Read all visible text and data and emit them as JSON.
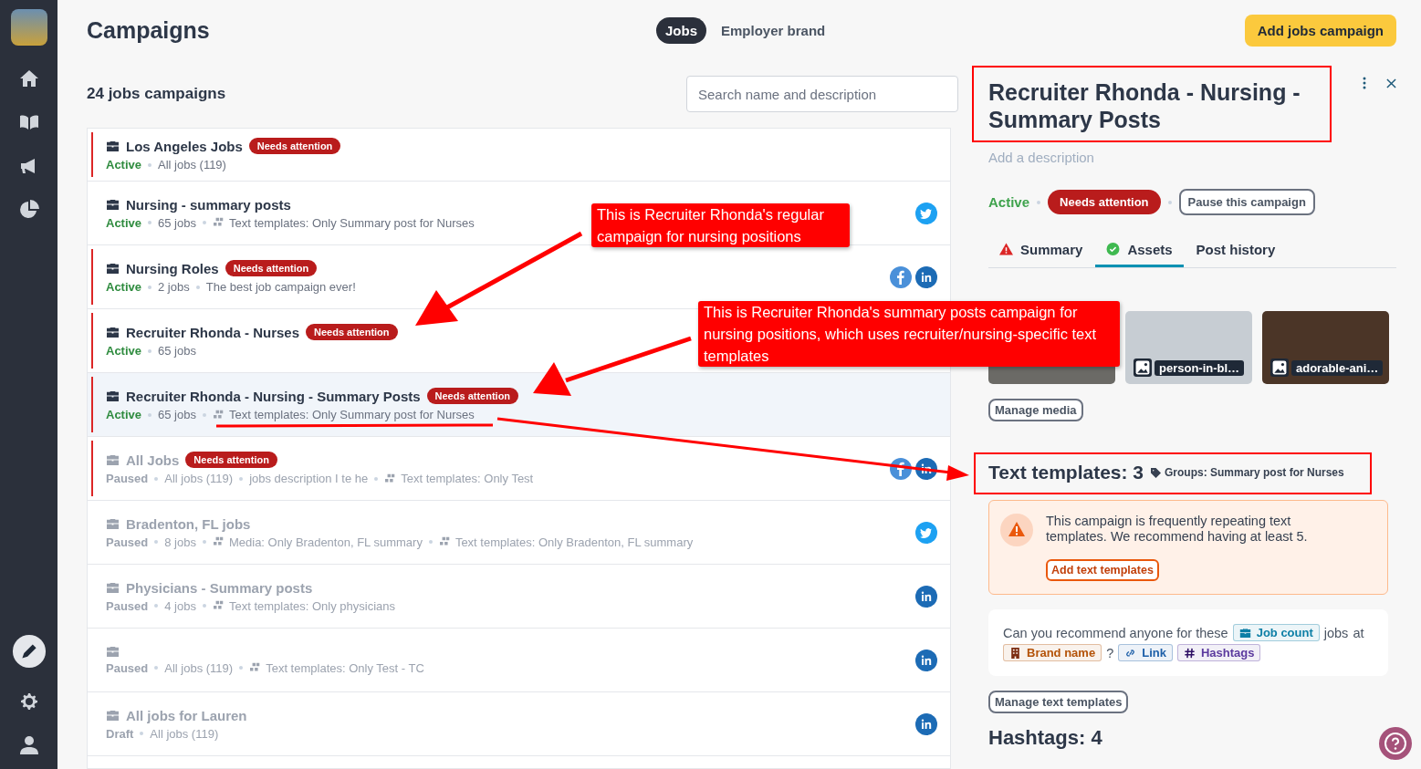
{
  "header": {
    "title": "Campaigns",
    "tabs": [
      {
        "label": "Jobs",
        "selected": true
      },
      {
        "label": "Employer brand",
        "selected": false
      }
    ],
    "action": "Add jobs campaign"
  },
  "list": {
    "count": "24 jobs campaigns",
    "search": {
      "placeholder": "Search name and description"
    },
    "campaigns": [
      {
        "title": "Los Angeles Jobs",
        "attention": "Needs attention",
        "status": "Active",
        "kind": "active",
        "selected": false,
        "meta": [
          {
            "text": "All jobs (119)",
            "group": false
          }
        ]
      },
      {
        "title": "Nursing - summary posts",
        "status": "Active",
        "kind": "active",
        "selected": false,
        "meta": [
          {
            "text": "65 jobs",
            "group": false
          },
          {
            "text": "Text templates: Only Summary post for Nurses",
            "group": true
          }
        ],
        "socials": [
          {
            "kind": "twitter"
          }
        ]
      },
      {
        "title": "Nursing Roles",
        "attention": "Needs attention",
        "status": "Active",
        "kind": "active",
        "selected": false,
        "meta": [
          {
            "text": "2 jobs",
            "group": false
          },
          {
            "text": "The best job campaign ever!",
            "group": false
          }
        ],
        "socials": [
          {
            "kind": "facebook"
          },
          {
            "kind": "linkedin"
          }
        ]
      },
      {
        "title": "Recruiter Rhonda - Nurses",
        "attention": "Needs attention",
        "status": "Active",
        "kind": "active",
        "selected": false,
        "meta": [
          {
            "text": "65 jobs",
            "group": false
          }
        ]
      },
      {
        "title": "Recruiter Rhonda - Nursing - Summary Posts",
        "attention": "Needs attention",
        "status": "Active",
        "kind": "active",
        "selected": true,
        "meta": [
          {
            "text": "65 jobs",
            "group": false
          },
          {
            "text": "Text templates: Only Summary post for Nurses",
            "group": true
          }
        ]
      },
      {
        "title": "All Jobs",
        "attention": "Needs attention",
        "status": "Paused",
        "kind": "paused",
        "selected": false,
        "meta": [
          {
            "text": "All jobs (119)",
            "group": false
          },
          {
            "text": "jobs description I te he",
            "group": false
          },
          {
            "text": "Text templates: Only Test",
            "group": true
          }
        ],
        "socials": [
          {
            "kind": "facebook"
          },
          {
            "kind": "linkedin"
          }
        ]
      },
      {
        "title": "Bradenton, FL jobs",
        "status": "Paused",
        "kind": "paused",
        "selected": false,
        "meta": [
          {
            "text": "8 jobs",
            "group": false
          },
          {
            "text": "Media: Only Bradenton, FL summary",
            "group": true
          },
          {
            "text": "Text templates: Only Bradenton, FL summary",
            "group": true
          }
        ],
        "socials": [
          {
            "kind": "twitter"
          }
        ]
      },
      {
        "title": "Physicians - Summary posts",
        "status": "Paused",
        "kind": "paused",
        "selected": false,
        "meta": [
          {
            "text": "4 jobs",
            "group": false
          },
          {
            "text": "Text templates: Only physicians",
            "group": true
          }
        ],
        "socials": [
          {
            "kind": "linkedin"
          }
        ]
      },
      {
        "status": "Paused",
        "kind": "paused",
        "selected": false,
        "meta": [
          {
            "text": "All jobs (119)",
            "group": false
          },
          {
            "text": "Text templates: Only Test - TC",
            "group": true
          }
        ],
        "socials": [
          {
            "kind": "linkedin"
          }
        ]
      },
      {
        "title": "All jobs for Lauren",
        "status": "Draft",
        "kind": "draft",
        "selected": false,
        "meta": [
          {
            "text": "All jobs (119)",
            "group": false
          }
        ],
        "socials": [
          {
            "kind": "linkedin"
          }
        ]
      }
    ]
  },
  "detail": {
    "title": "Recruiter Rhonda - Nursing - Summary Posts",
    "description": {
      "placeholder": "Add a description"
    },
    "status": "Active",
    "attention": "Needs attention",
    "pause": "Pause this campaign",
    "tabs": [
      {
        "label": "Summary",
        "warning": true,
        "complete": false,
        "selected": false
      },
      {
        "label": "Assets",
        "warning": false,
        "complete": true,
        "selected": true
      },
      {
        "label": "Post history",
        "warning": false,
        "complete": false,
        "selected": false
      }
    ],
    "media": {
      "thumbnails": [
        {
          "kind": "covered"
        },
        {
          "kind": "captioned",
          "caption": "person-in-bl…"
        },
        {
          "kind": "captioned",
          "caption": "adorable-ani…"
        }
      ],
      "button": "Manage media"
    },
    "templates": {
      "title": "Text templates: 3",
      "groups": "Groups: Summary post for Nurses",
      "warning": {
        "text": "This campaign is frequently repeating text templates. We recommend having at least 5.",
        "button": "Add text templates"
      },
      "preview": [
        {
          "kind": "text",
          "text": "Can you recommend anyone for these"
        },
        {
          "kind": "token",
          "text": "Job count",
          "color": "#0e7fa6"
        },
        {
          "kind": "text",
          "text": "jobs"
        },
        {
          "kind": "text",
          "text": "at"
        },
        {
          "kind": "token",
          "text": "Brand name",
          "color": "#b45309"
        },
        {
          "kind": "text",
          "text": "?"
        },
        {
          "kind": "token",
          "text": "Link",
          "color": "#1d5fa8"
        },
        {
          "kind": "token",
          "text": "Hashtags",
          "color": "#5b3a9e"
        }
      ],
      "button": "Manage text templates"
    },
    "hashtags": "Hashtags: 4"
  },
  "annotations": [
    "This is Recruiter Rhonda's regular campaign for nursing positions",
    "This is Recruiter Rhonda's summary posts campaign for nursing positions, which uses recruiter/nursing-specific text templates"
  ]
}
